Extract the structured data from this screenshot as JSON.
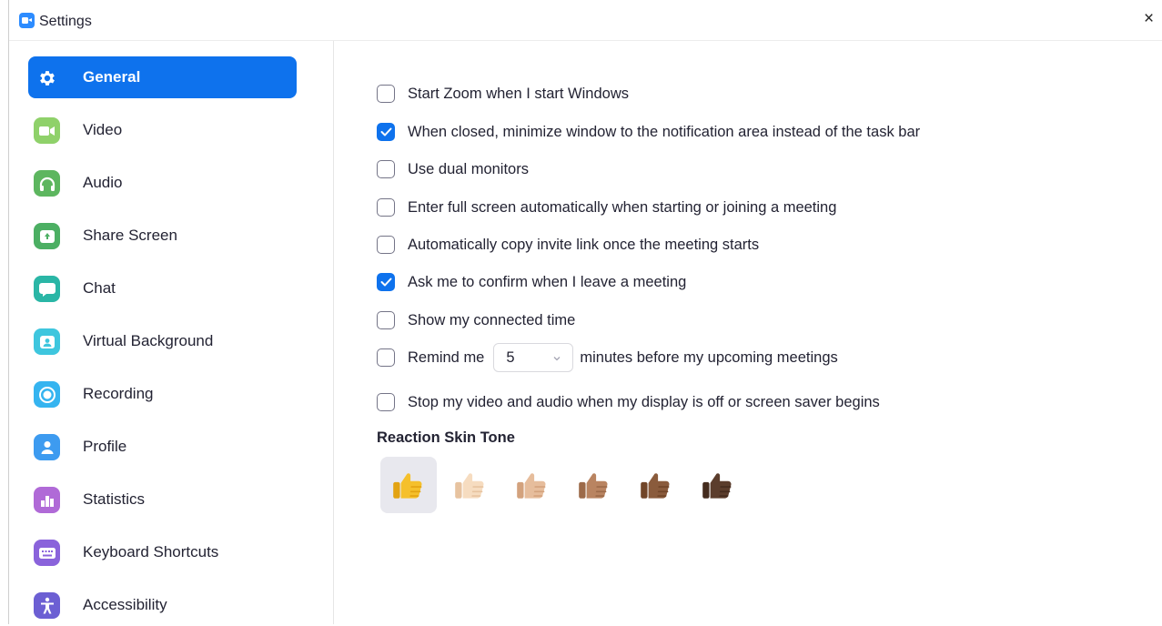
{
  "window": {
    "title": "Settings",
    "close_glyph": "×"
  },
  "sidebar": {
    "items": [
      {
        "label": "General",
        "icon": "gear-icon",
        "color": "#0e72ed",
        "active": true
      },
      {
        "label": "Video",
        "icon": "video-camera-icon",
        "color": "#8fd16a"
      },
      {
        "label": "Audio",
        "icon": "headphones-icon",
        "color": "#5db65f"
      },
      {
        "label": "Share Screen",
        "icon": "share-screen-icon",
        "color": "#4caf63"
      },
      {
        "label": "Chat",
        "icon": "chat-bubble-icon",
        "color": "#2ab6a6"
      },
      {
        "label": "Virtual Background",
        "icon": "person-background-icon",
        "color": "#3ec6de"
      },
      {
        "label": "Recording",
        "icon": "record-icon",
        "color": "#35b4f0"
      },
      {
        "label": "Profile",
        "icon": "person-icon",
        "color": "#3d9bf0"
      },
      {
        "label": "Statistics",
        "icon": "bar-chart-icon",
        "color": "#b06ad7"
      },
      {
        "label": "Keyboard Shortcuts",
        "icon": "keyboard-icon",
        "color": "#8a63db"
      },
      {
        "label": "Accessibility",
        "icon": "accessibility-icon",
        "color": "#6c5fd3"
      }
    ]
  },
  "general": {
    "options": [
      {
        "label": "Start Zoom when I start Windows",
        "checked": false
      },
      {
        "label": "When closed, minimize window to the notification area instead of the task bar",
        "checked": true
      },
      {
        "label": "Use dual monitors",
        "checked": false
      },
      {
        "label": "Enter full screen automatically when starting or joining a meeting",
        "checked": false
      },
      {
        "label": "Automatically copy invite link once the meeting starts",
        "checked": false
      },
      {
        "label": "Ask me to confirm when I leave a meeting",
        "checked": true
      },
      {
        "label": "Show my connected time",
        "checked": false
      }
    ],
    "remind": {
      "prefix": "Remind me",
      "value": "5",
      "suffix": "minutes before my upcoming meetings",
      "checked": false
    },
    "stop_video": {
      "label": "Stop my video and audio when my display is off or screen saver begins",
      "checked": false
    },
    "reaction_skin_tone": {
      "title": "Reaction Skin Tone",
      "tones": [
        {
          "name": "default",
          "color": "#f5c02c",
          "shade": "#e3a312",
          "selected": true
        },
        {
          "name": "light",
          "color": "#f6dcc0",
          "shade": "#e7c3a0"
        },
        {
          "name": "medium-light",
          "color": "#e6bd9c",
          "shade": "#d3a27d"
        },
        {
          "name": "medium",
          "color": "#b98461",
          "shade": "#9c6a49"
        },
        {
          "name": "medium-dark",
          "color": "#8a5b3c",
          "shade": "#714528"
        },
        {
          "name": "dark",
          "color": "#5b3d2c",
          "shade": "#452c1e"
        }
      ]
    }
  },
  "colors": {
    "accent": "#0e72ed",
    "checkbox_border": "#747487",
    "text": "#232333"
  }
}
